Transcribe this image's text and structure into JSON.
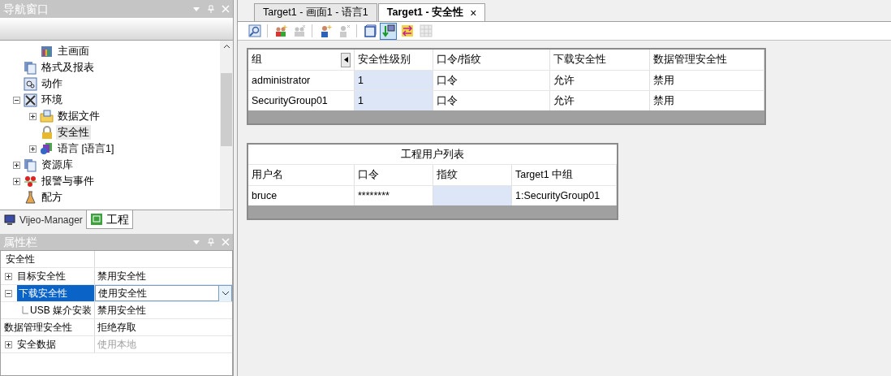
{
  "nav_panel": {
    "title": "导航窗口",
    "tree": [
      {
        "children": [
          {
            "label": "主画面",
            "kind": "screen"
          }
        ]
      },
      {
        "label": "格式及报表",
        "kind": "pages"
      },
      {
        "label": "动作",
        "kind": "action"
      },
      {
        "label": "环境",
        "kind": "tools",
        "expanded": true,
        "children": [
          {
            "label": "数据文件",
            "kind": "folder",
            "expanded": false
          },
          {
            "label": "安全性",
            "kind": "lock",
            "selected": true
          },
          {
            "label": "语言 [语言1]",
            "kind": "lang",
            "expanded": false
          }
        ]
      },
      {
        "label": "资源库",
        "kind": "pages",
        "expanded": false
      },
      {
        "label": "报警与事件",
        "kind": "alarm",
        "expanded": false
      },
      {
        "label": "配方",
        "kind": "flask"
      }
    ],
    "tabs": [
      {
        "label": "Vijeo-Manager",
        "selected": false
      },
      {
        "label": "工程",
        "selected": true
      }
    ]
  },
  "property_panel": {
    "title": "属性栏",
    "rows": [
      {
        "kind": "category",
        "name": "安全性"
      },
      {
        "kind": "group",
        "name": "目标安全性",
        "value": "禁用安全性",
        "expanded": false,
        "selected": false,
        "disabled": false
      },
      {
        "kind": "group",
        "name": "下载安全性",
        "value": "使用安全性",
        "expanded": true,
        "selected": true,
        "disabled": false
      },
      {
        "kind": "child",
        "name": "USB 媒介安装",
        "value": "禁用安全性",
        "selected": false,
        "disabled": false
      },
      {
        "kind": "plain",
        "name": "数据管理安全性",
        "value": "拒绝存取",
        "selected": false,
        "disabled": false
      },
      {
        "kind": "group",
        "name": "安全数据",
        "value": "使用本地",
        "expanded": false,
        "selected": false,
        "disabled": true
      }
    ]
  },
  "editor_tabs": [
    {
      "label": "Target1 - 画面1 - 语言1",
      "selected": false
    },
    {
      "label": "Target1 - 安全性",
      "selected": true,
      "close": "×"
    }
  ],
  "toolbar": [
    {
      "kind": "magnifier",
      "disabled": false,
      "selected": false
    },
    {
      "kind": "group-add",
      "disabled": false,
      "selected": false
    },
    {
      "kind": "group-remove",
      "disabled": true,
      "selected": false
    },
    {
      "kind": "user-add",
      "disabled": false,
      "selected": false
    },
    {
      "kind": "user-remove",
      "disabled": true,
      "selected": false
    },
    {
      "kind": "cube",
      "disabled": false,
      "selected": false
    },
    {
      "kind": "download",
      "disabled": false,
      "selected": true
    },
    {
      "kind": "swap",
      "disabled": false,
      "selected": false
    },
    {
      "kind": "grid",
      "disabled": true,
      "selected": false
    }
  ],
  "groups_table": {
    "columns": [
      {
        "label": "组",
        "selected": false
      },
      {
        "label": "安全性级别",
        "selected": true
      },
      {
        "label": "口令/指纹",
        "selected": false
      },
      {
        "label": "下载安全性",
        "selected": false
      },
      {
        "label": "数据管理安全性",
        "selected": false
      }
    ],
    "rows": [
      [
        "administrator",
        "1",
        "口令",
        "允许",
        "禁用"
      ],
      [
        "SecurityGroup01",
        "1",
        "口令",
        "允许",
        "禁用"
      ]
    ]
  },
  "users_table": {
    "title": "工程用户列表",
    "columns": [
      {
        "label": "用户名",
        "selected": false
      },
      {
        "label": "口令",
        "selected": false
      },
      {
        "label": "指纹",
        "selected": true
      },
      {
        "label": "Target1 中组",
        "selected": false
      }
    ],
    "rows": [
      [
        "bruce",
        "********",
        "",
        "1:SecurityGroup01"
      ]
    ]
  }
}
